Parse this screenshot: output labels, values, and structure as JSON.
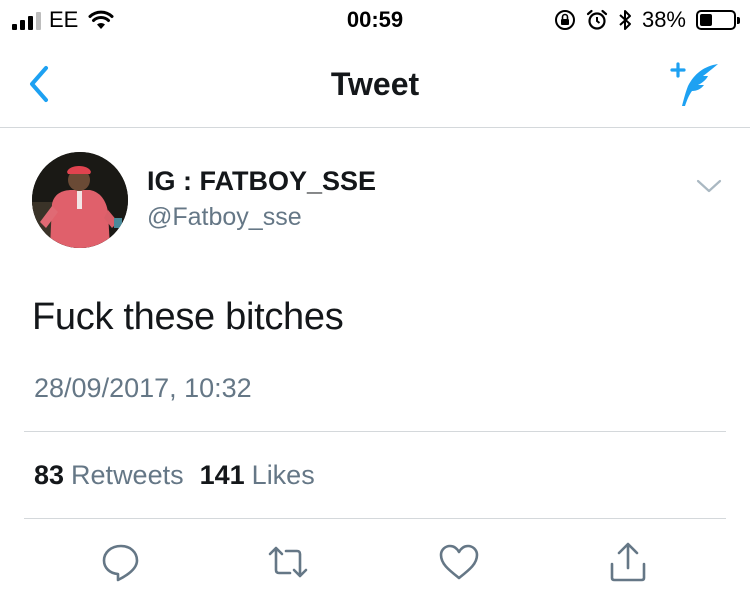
{
  "status_bar": {
    "carrier": "EE",
    "time": "00:59",
    "battery_percent": "38%",
    "battery_level": 0.38,
    "icons": [
      "signal-icon",
      "wifi-icon",
      "orientation-lock-icon",
      "alarm-icon",
      "bluetooth-icon",
      "battery-icon"
    ]
  },
  "nav": {
    "title": "Tweet",
    "back_icon": "chevron-left-icon",
    "compose_icon": "compose-tweet-icon"
  },
  "colors": {
    "accent": "#1da1f2",
    "text_primary": "#14171a",
    "text_secondary": "#657786",
    "divider": "#d4d8db"
  },
  "tweet": {
    "display_name": "IG  : FATBOY_SSE",
    "username": "@Fatboy_sse",
    "text": "Fuck these bitches",
    "timestamp": "28/09/2017, 10:32",
    "retweets_count": "83",
    "retweets_label": "Retweets",
    "likes_count": "141",
    "likes_label": "Likes"
  },
  "actions": [
    "reply-icon",
    "retweet-icon",
    "like-icon",
    "share-icon"
  ]
}
